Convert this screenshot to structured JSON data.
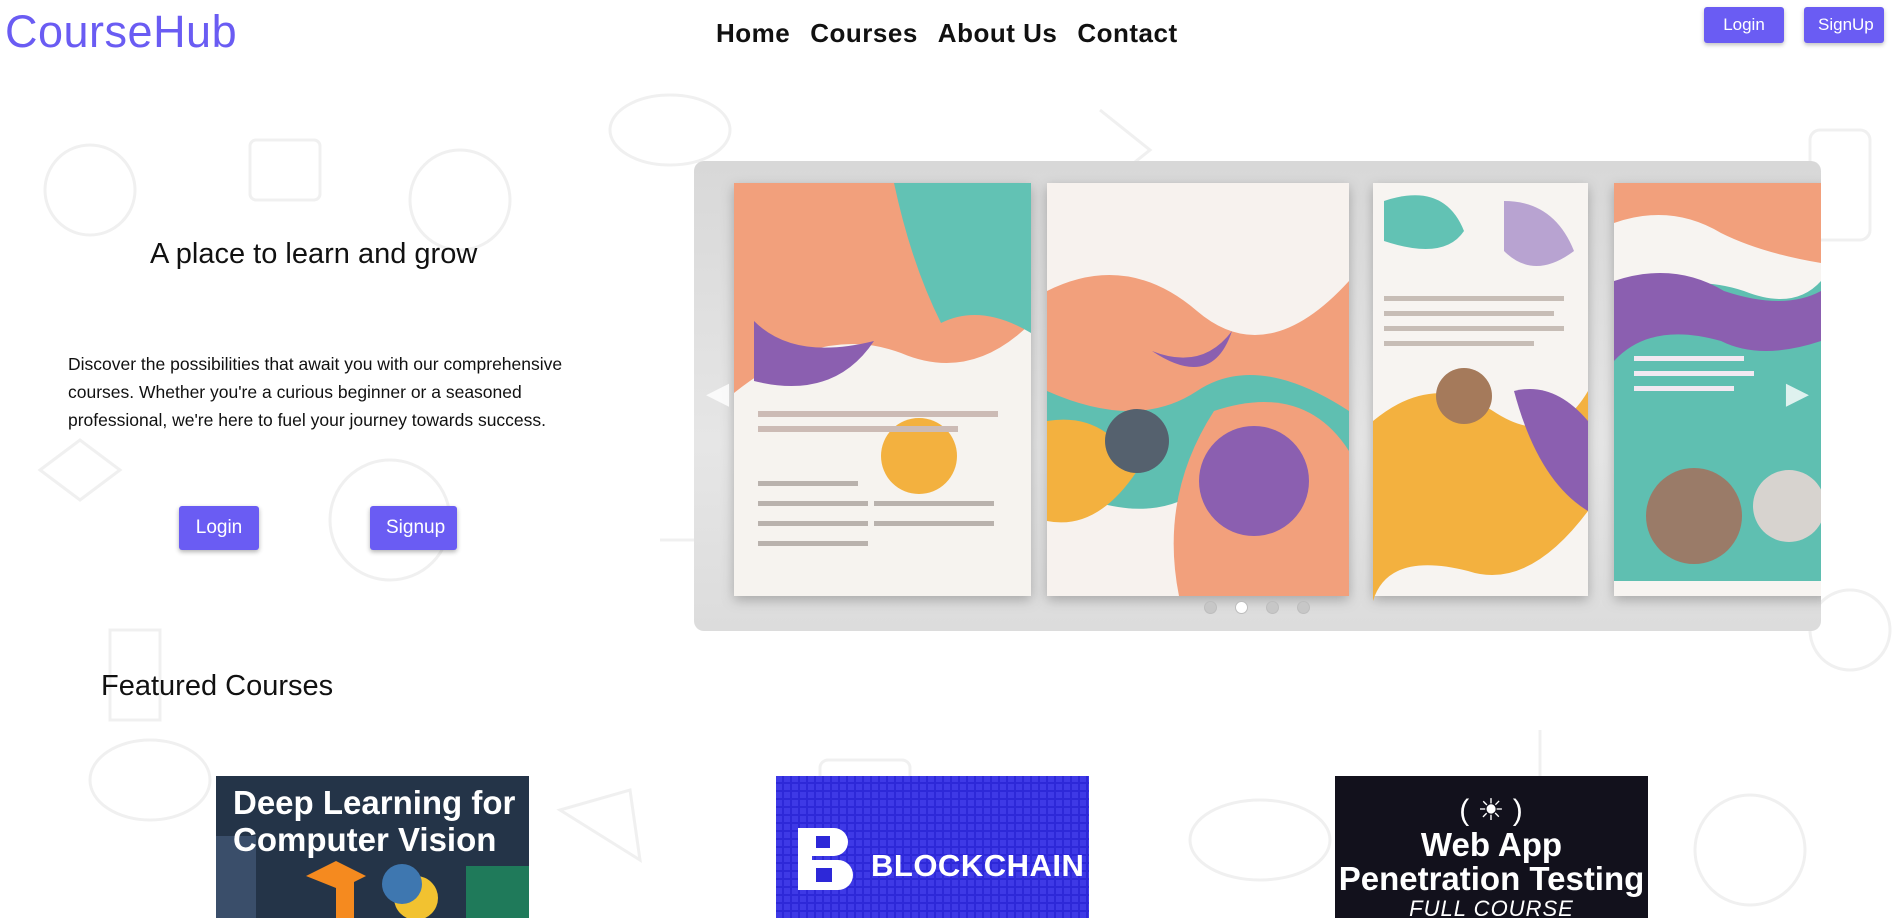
{
  "brand": {
    "name": "CourseHub",
    "accent": "#6a5cf3"
  },
  "nav": {
    "links": [
      "Home",
      "Courses",
      "About Us",
      "Contact"
    ],
    "login_label": "Login",
    "signup_label": "SignUp"
  },
  "hero": {
    "title": "A place to learn and grow",
    "description": "Discover the possibilities that await you with our comprehensive courses. Whether you're a curious beginner or a seasoned professional, we're here to fuel your journey towards success.",
    "login_label": "Login",
    "signup_label": "Signup"
  },
  "carousel": {
    "slides": 4,
    "active_slide": 2
  },
  "featured": {
    "title": "Featured Courses",
    "courses": [
      {
        "title_line1": "Deep Learning for",
        "title_line2": "Computer Vision"
      },
      {
        "title": "BLOCKCHAIN"
      },
      {
        "title_line1": "Web App",
        "title_line2": "Penetration Testing",
        "subtitle": "FULL COURSE"
      }
    ]
  }
}
